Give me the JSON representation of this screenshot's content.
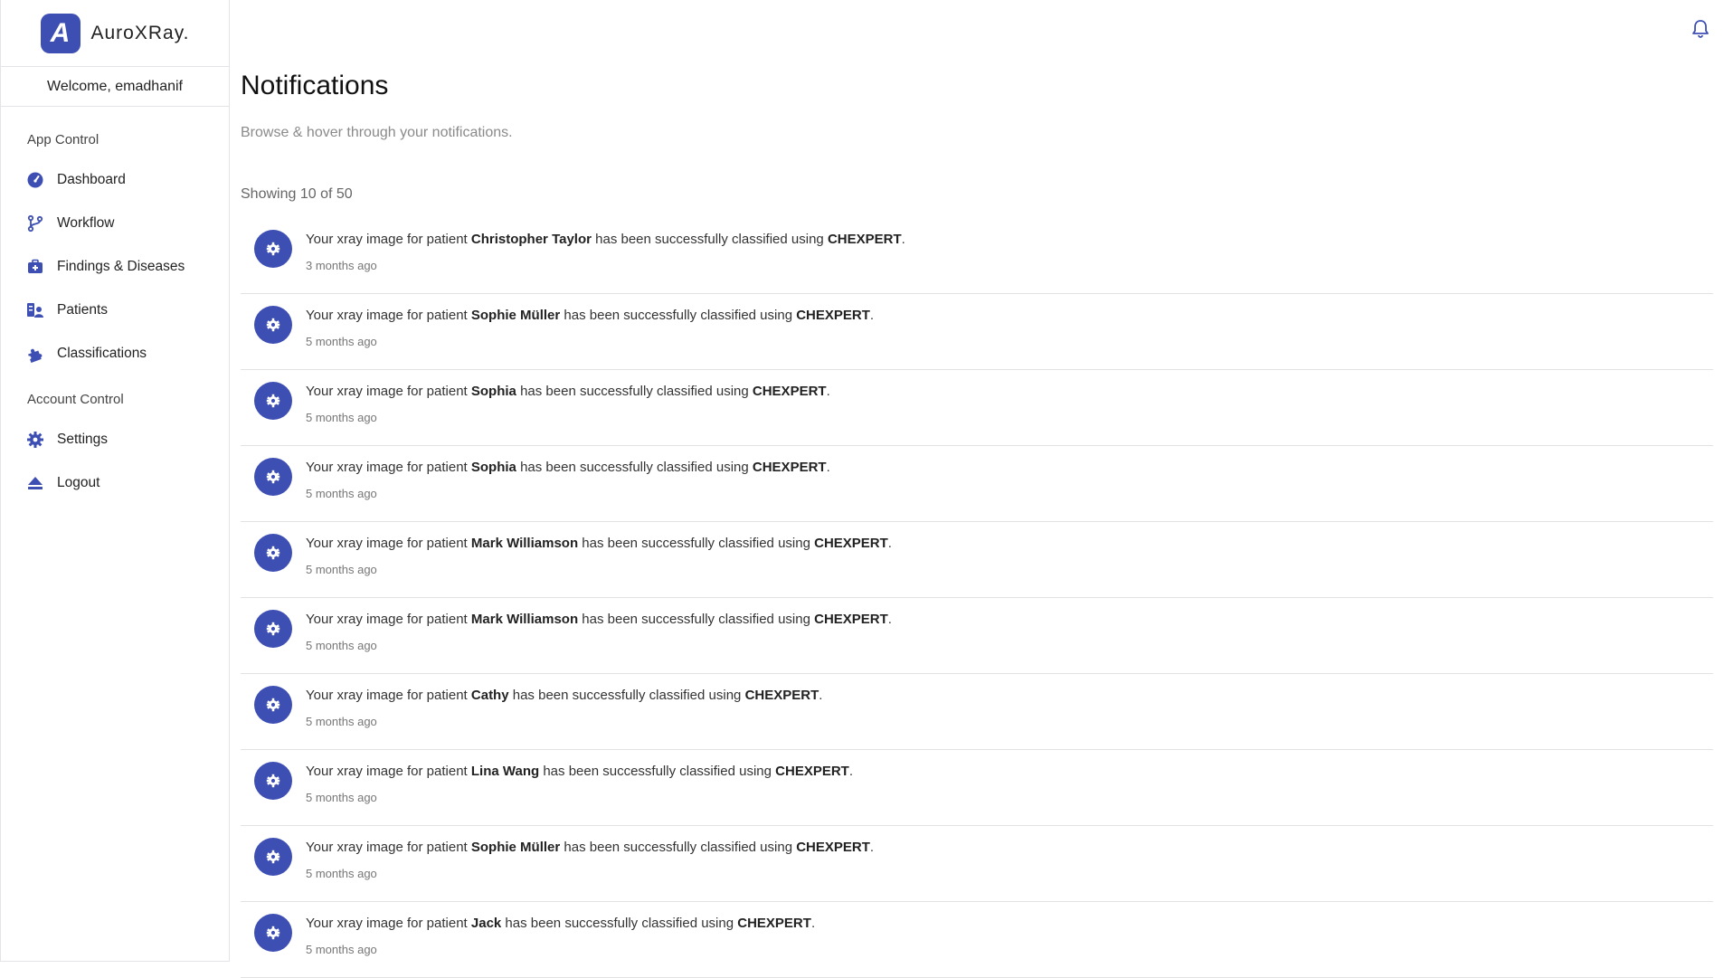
{
  "brand": {
    "logo_letter": "A",
    "name": "AuroXRay."
  },
  "welcome": "Welcome, emadhanif",
  "sidebar": {
    "app_section": "App Control",
    "app_items": [
      {
        "label": "Dashboard",
        "icon": "gauge-icon"
      },
      {
        "label": "Workflow",
        "icon": "branch-icon"
      },
      {
        "label": "Findings & Diseases",
        "icon": "medkit-icon"
      },
      {
        "label": "Patients",
        "icon": "patients-icon"
      },
      {
        "label": "Classifications",
        "icon": "puzzle-icon"
      }
    ],
    "account_section": "Account Control",
    "account_items": [
      {
        "label": "Settings",
        "icon": "gear-icon"
      },
      {
        "label": "Logout",
        "icon": "eject-icon"
      }
    ]
  },
  "header": {
    "notifications_icon": "bell-icon"
  },
  "page": {
    "title": "Notifications",
    "subtitle": "Browse & hover through your notifications.",
    "showing": "Showing 10 of 50"
  },
  "notifications": [
    {
      "prefix": "Your xray image for patient ",
      "patient": "Christopher Taylor",
      "middle": " has been successfully classified using ",
      "model": "CHEXPERT",
      "suffix": ".",
      "time": "3 months ago"
    },
    {
      "prefix": "Your xray image for patient ",
      "patient": "Sophie Müller",
      "middle": " has been successfully classified using ",
      "model": "CHEXPERT",
      "suffix": ".",
      "time": "5 months ago"
    },
    {
      "prefix": "Your xray image for patient ",
      "patient": "Sophia",
      "middle": " has been successfully classified using ",
      "model": "CHEXPERT",
      "suffix": ".",
      "time": "5 months ago"
    },
    {
      "prefix": "Your xray image for patient ",
      "patient": "Sophia",
      "middle": " has been successfully classified using ",
      "model": "CHEXPERT",
      "suffix": ".",
      "time": "5 months ago"
    },
    {
      "prefix": "Your xray image for patient ",
      "patient": "Mark Williamson",
      "middle": " has been successfully classified using ",
      "model": "CHEXPERT",
      "suffix": ".",
      "time": "5 months ago"
    },
    {
      "prefix": "Your xray image for patient ",
      "patient": "Mark Williamson",
      "middle": " has been successfully classified using ",
      "model": "CHEXPERT",
      "suffix": ".",
      "time": "5 months ago"
    },
    {
      "prefix": "Your xray image for patient ",
      "patient": "Cathy",
      "middle": " has been successfully classified using ",
      "model": "CHEXPERT",
      "suffix": ".",
      "time": "5 months ago"
    },
    {
      "prefix": "Your xray image for patient ",
      "patient": "Lina Wang",
      "middle": " has been successfully classified using ",
      "model": "CHEXPERT",
      "suffix": ".",
      "time": "5 months ago"
    },
    {
      "prefix": "Your xray image for patient ",
      "patient": "Sophie Müller",
      "middle": " has been successfully classified using ",
      "model": "CHEXPERT",
      "suffix": ".",
      "time": "5 months ago"
    },
    {
      "prefix": "Your xray image for patient ",
      "patient": "Jack",
      "middle": " has been successfully classified using ",
      "model": "CHEXPERT",
      "suffix": ".",
      "time": "5 months ago"
    }
  ],
  "colors": {
    "accent": "#3e4fb4",
    "divider": "#e2e2e2"
  }
}
